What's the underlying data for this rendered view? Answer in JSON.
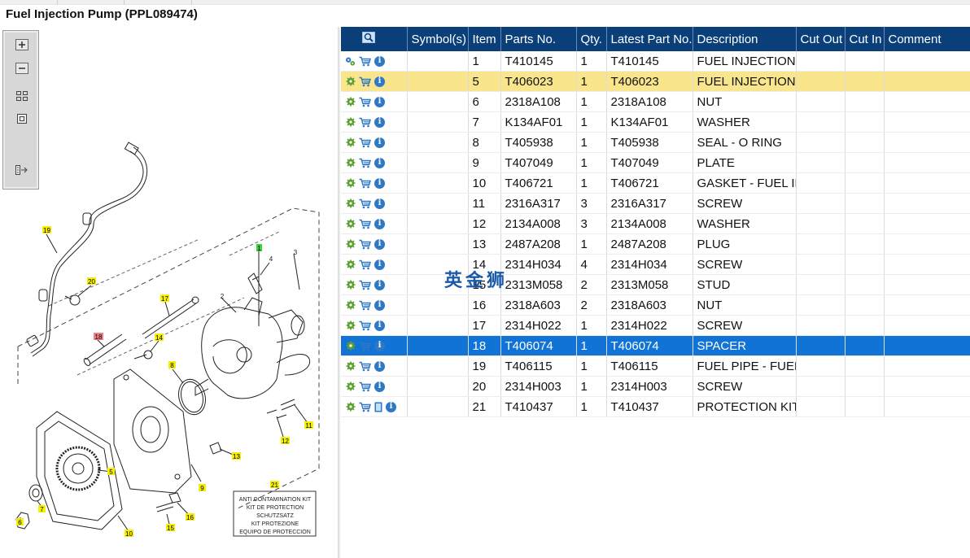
{
  "window": {
    "title": "Fuel Injection Pump (PPL089474)"
  },
  "toolbox": {
    "buttons": [
      {
        "name": "zoom-in-icon"
      },
      {
        "name": "zoom-out-icon"
      },
      {
        "name": "fit-all-icon"
      },
      {
        "name": "fit-window-icon"
      },
      {
        "name": "split-view-icon"
      }
    ]
  },
  "drawing": {
    "callouts": [
      "19",
      "20",
      "17",
      "18",
      "14",
      "8",
      "2",
      "3",
      "4",
      "1",
      "9",
      "11",
      "12",
      "13",
      "5",
      "6",
      "7",
      "10",
      "16",
      "15",
      "21"
    ],
    "kit_label": [
      "ANTI CONTAMINATION KIT",
      "KIT DE PROTECTION",
      "SCHUTZSATZ",
      "KIT PROTEZIONE",
      "EQUIPO DE PROTECCION"
    ]
  },
  "table": {
    "columns": [
      "",
      "Symbol(s)",
      "Item",
      "Parts No.",
      "Qty.",
      "Latest Part No.",
      "Description",
      "Cut Out",
      "Cut In",
      "Comment"
    ],
    "rows": [
      {
        "item": "1",
        "part": "T410145",
        "qty": "1",
        "latest": "T410145",
        "desc": "FUEL INJECTION PU",
        "icons": "gears",
        "state": ""
      },
      {
        "item": "5",
        "part": "T406023",
        "qty": "1",
        "latest": "T406023",
        "desc": "FUEL INJECTION PU",
        "icons": "gear",
        "state": "yellow"
      },
      {
        "item": "6",
        "part": "2318A108",
        "qty": "1",
        "latest": "2318A108",
        "desc": "NUT",
        "icons": "gear",
        "state": ""
      },
      {
        "item": "7",
        "part": "K134AF01",
        "qty": "1",
        "latest": "K134AF01",
        "desc": "WASHER",
        "icons": "gear",
        "state": ""
      },
      {
        "item": "8",
        "part": "T405938",
        "qty": "1",
        "latest": "T405938",
        "desc": "SEAL - O RING",
        "icons": "gear",
        "state": ""
      },
      {
        "item": "9",
        "part": "T407049",
        "qty": "1",
        "latest": "T407049",
        "desc": "PLATE",
        "icons": "gear",
        "state": ""
      },
      {
        "item": "10",
        "part": "T406721",
        "qty": "1",
        "latest": "T406721",
        "desc": "GASKET - FUEL INJ",
        "icons": "gear",
        "state": ""
      },
      {
        "item": "11",
        "part": "2316A317",
        "qty": "3",
        "latest": "2316A317",
        "desc": "SCREW",
        "icons": "gear",
        "state": ""
      },
      {
        "item": "12",
        "part": "2134A008",
        "qty": "3",
        "latest": "2134A008",
        "desc": "WASHER",
        "icons": "gear",
        "state": ""
      },
      {
        "item": "13",
        "part": "2487A208",
        "qty": "1",
        "latest": "2487A208",
        "desc": "PLUG",
        "icons": "gear",
        "state": ""
      },
      {
        "item": "14",
        "part": "2314H034",
        "qty": "4",
        "latest": "2314H034",
        "desc": "SCREW",
        "icons": "gear",
        "state": ""
      },
      {
        "item": "15",
        "part": "2313M058",
        "qty": "2",
        "latest": "2313M058",
        "desc": "STUD",
        "icons": "gear",
        "state": ""
      },
      {
        "item": "16",
        "part": "2318A603",
        "qty": "2",
        "latest": "2318A603",
        "desc": "NUT",
        "icons": "gear",
        "state": ""
      },
      {
        "item": "17",
        "part": "2314H022",
        "qty": "1",
        "latest": "2314H022",
        "desc": "SCREW",
        "icons": "gear",
        "state": ""
      },
      {
        "item": "18",
        "part": "T406074",
        "qty": "1",
        "latest": "T406074",
        "desc": "SPACER",
        "icons": "gear",
        "state": "blue"
      },
      {
        "item": "19",
        "part": "T406115",
        "qty": "1",
        "latest": "T406115",
        "desc": "FUEL PIPE - FUEL P",
        "icons": "gear",
        "state": ""
      },
      {
        "item": "20",
        "part": "2314H003",
        "qty": "1",
        "latest": "2314H003",
        "desc": "SCREW",
        "icons": "gear",
        "state": ""
      },
      {
        "item": "21",
        "part": "T410437",
        "qty": "1",
        "latest": "T410437",
        "desc": "PROTECTION KIT",
        "icons": "gear-book",
        "state": ""
      }
    ]
  },
  "watermark": "英金狮",
  "colors": {
    "header_bg": "#0b3f7a",
    "selected_row": "#1273d6",
    "highlight_row": "#f8e58c",
    "callout_yellow": "#f5ef00",
    "callout_red": "#f08080",
    "callout_green": "#3bd13b"
  }
}
